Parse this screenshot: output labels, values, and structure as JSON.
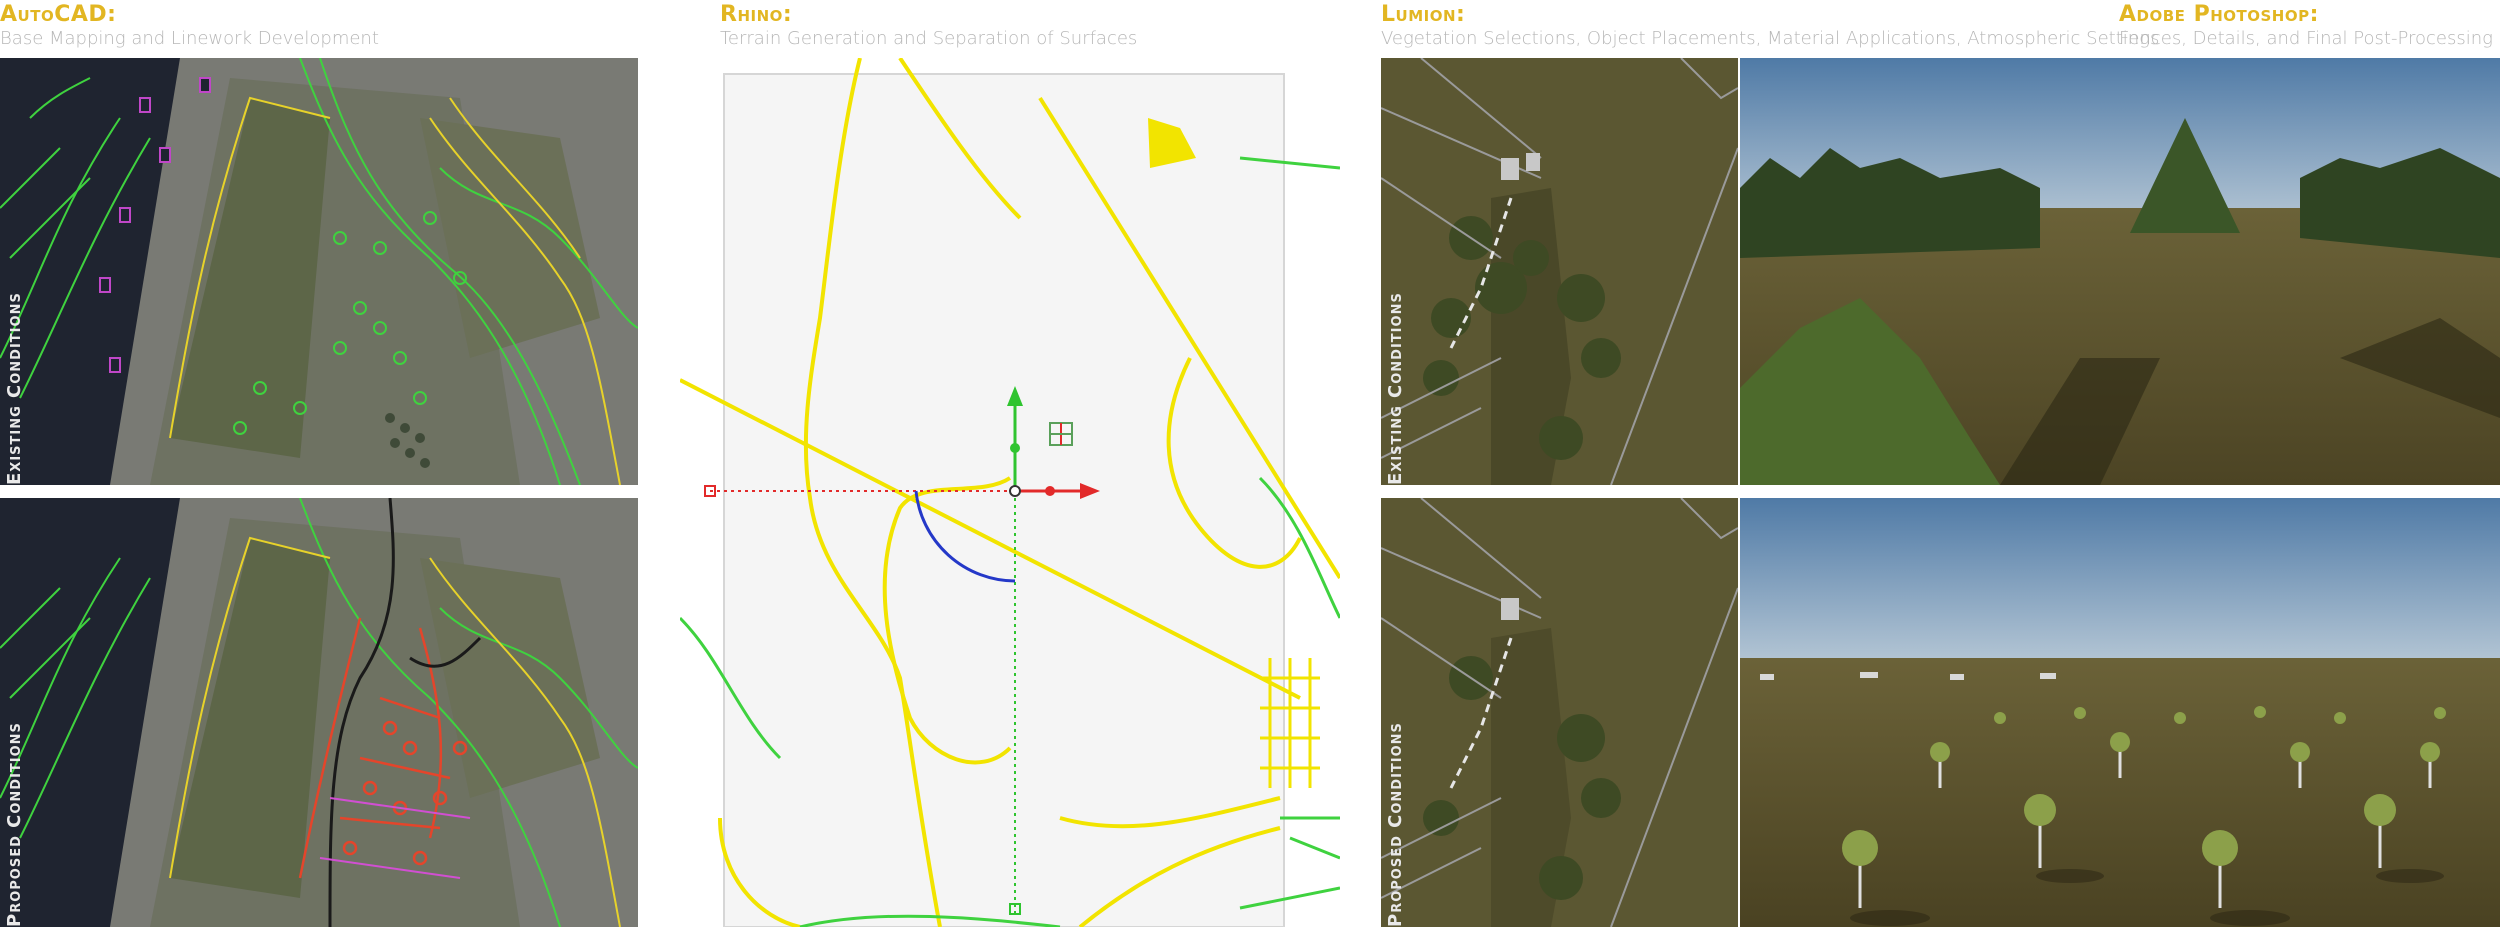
{
  "headers": [
    {
      "title": "AutoCAD:",
      "subtitle": "Base Mapping and Linework Development"
    },
    {
      "title": "Rhino:",
      "subtitle": "Terrain Generation and Separation of Surfaces"
    },
    {
      "title": "Lumion:",
      "subtitle": "Vegetation Selections, Object Placements, Material Applications, Atmospheric Settings"
    },
    {
      "title": "Adobe Photoshop:",
      "subtitle": "Fences, Details, and Final Post-Processing"
    }
  ],
  "row_labels": {
    "existing": "Existing Conditions",
    "proposed": "Proposed Conditions"
  },
  "colors": {
    "header_title": "#e2b622",
    "header_subtitle": "#b7b7b7",
    "cad_background": "#1f2430",
    "cad_linework_green": "#3fd23f",
    "cad_linework_yellow": "#e7d22a",
    "cad_proposed_red": "#e4452b",
    "rhino_background": "#ffffff",
    "rhino_linework": "#f2e400",
    "sky_blue": "#6e93b8",
    "field_olive": "#5a5230"
  },
  "icons": {
    "gumball": "rhino-gumball-icon",
    "plane_grid": "grid-icon"
  }
}
